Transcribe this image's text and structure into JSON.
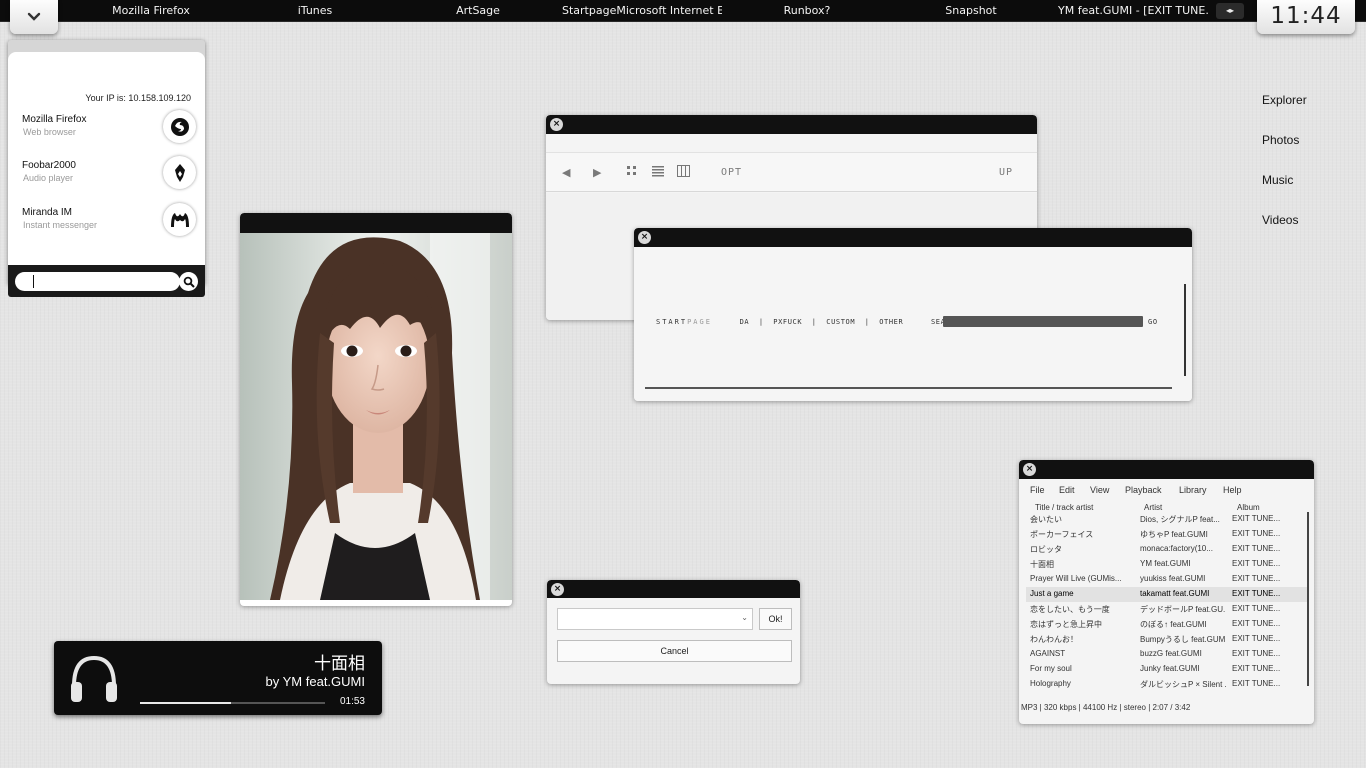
{
  "taskbar": {
    "tasks": [
      "Mozilla Firefox",
      "iTunes",
      "ArtSage",
      "StartpageMicrosoft Internet E...",
      "Runbox?",
      "Snapshot",
      "YM feat.GUMI - [EXIT TUNE..."
    ],
    "clock": "11:44"
  },
  "launcher": {
    "ip": "Your IP is: 10.158.109.120",
    "apps": [
      {
        "name": "Mozilla Firefox",
        "desc": "Web browser",
        "icon": "firefox-icon"
      },
      {
        "name": "Foobar2000",
        "desc": "Audio player",
        "icon": "foobar-icon"
      },
      {
        "name": "Miranda IM",
        "desc": "Instant messenger",
        "icon": "miranda-icon"
      }
    ]
  },
  "shortcuts": [
    "Explorer",
    "Photos",
    "Music",
    "Videos"
  ],
  "explorer": {
    "opt": "OPT",
    "up": "UP"
  },
  "startpage": {
    "logo_a": "START",
    "logo_b": "PAGE",
    "links": "DA  |  PXFUCK  |  CUSTOM  |  OTHER",
    "search_label": "SEARCH:",
    "go": "GO"
  },
  "dialog": {
    "ok": "Ok!",
    "cancel": "Cancel"
  },
  "now_playing": {
    "title": "十面相",
    "artist": "by YM feat.GUMI",
    "time": "01:53",
    "progress": 0.49
  },
  "foobar": {
    "menu": [
      "File",
      "Edit",
      "View",
      "Playback",
      "Library",
      "Help"
    ],
    "columns": [
      "Title / track artist",
      "Artist",
      "Album"
    ],
    "rows": [
      [
        "会いたい",
        "Dios, シグナルP feat...",
        "EXIT TUNE..."
      ],
      [
        "ポーカーフェイス",
        "ゆちゃP feat.GUMI",
        "EXIT TUNE..."
      ],
      [
        "ロビッタ",
        "monaca:factory(10...",
        "EXIT TUNE..."
      ],
      [
        "十面相",
        "YM feat.GUMI",
        "EXIT TUNE..."
      ],
      [
        "Prayer Will Live (GUMis...",
        "yuukiss feat.GUMI",
        "EXIT TUNE..."
      ],
      [
        "Just a game",
        "takamatt feat.GUMI",
        "EXIT TUNE..."
      ],
      [
        "恋をしたい、もう一度",
        "デッドボールP feat.GU...",
        "EXIT TUNE..."
      ],
      [
        "恋はずっと急上昇中",
        "のぼる↑ feat.GUMI",
        "EXIT TUNE..."
      ],
      [
        "わんわんお！",
        "Bumpyうるし feat.GUMI",
        "EXIT TUNE..."
      ],
      [
        "AGAINST",
        "buzzG feat.GUMI",
        "EXIT TUNE..."
      ],
      [
        "For my soul",
        "Junky feat.GUMI",
        "EXIT TUNE..."
      ],
      [
        "Holography",
        "ダルビッシュP × Silent ...",
        "EXIT TUNE..."
      ]
    ],
    "selected_row": 5,
    "status": "MP3 | 320 kbps | 44100 Hz | stereo | 2:07 / 3:42"
  }
}
